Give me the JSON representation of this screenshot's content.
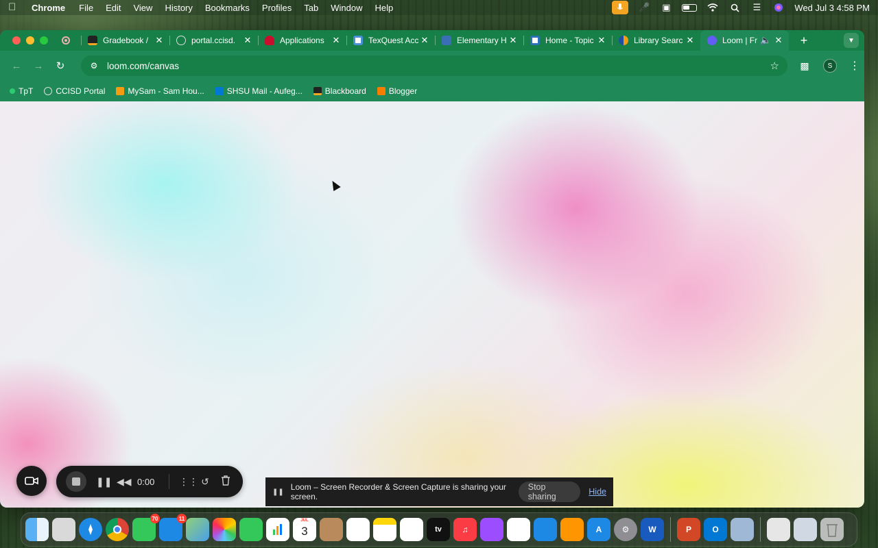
{
  "menubar": {
    "app_name": "Chrome",
    "menus": [
      "File",
      "Edit",
      "View",
      "History",
      "Bookmarks",
      "Profiles",
      "Tab",
      "Window",
      "Help"
    ],
    "datetime": "Wed Jul 3  4:58 PM"
  },
  "tabs": [
    {
      "title": "Gradebook /",
      "favicon_color": "#f5a623"
    },
    {
      "title": "portal.ccisd.",
      "favicon_color": "#cccccc"
    },
    {
      "title": "Applications",
      "favicon_color": "#c8102e"
    },
    {
      "title": "TexQuest Acc",
      "favicon_color": "#4a90d9"
    },
    {
      "title": "Elementary H",
      "favicon_color": "#3a6fb5"
    },
    {
      "title": "Home - Topic",
      "favicon_color": "#2d72b8"
    },
    {
      "title": "Library Searc",
      "favicon_color": "#f39c12"
    },
    {
      "title": "Loom | Fr",
      "favicon_color": "#625df5",
      "active": true
    }
  ],
  "toolbar": {
    "url": "loom.com/canvas",
    "profile_initial": "S"
  },
  "bookmarks": [
    {
      "label": "TpT",
      "color": "#2ecc71"
    },
    {
      "label": "CCISD Portal",
      "color": "#dddddd"
    },
    {
      "label": "MySam - Sam Hou...",
      "color": "#f39c12"
    },
    {
      "label": "SHSU Mail - Aufeg...",
      "color": "#0078d4"
    },
    {
      "label": "Blackboard",
      "color": "#f5a623"
    },
    {
      "label": "Blogger",
      "color": "#f57d00"
    }
  ],
  "loom": {
    "timer": "0:00"
  },
  "share_bar": {
    "message": "Loom – Screen Recorder & Screen Capture is sharing your screen.",
    "stop_label": "Stop sharing",
    "hide_label": "Hide"
  },
  "dock": {
    "mail_badge": "11",
    "messages_badge": "70",
    "calendar_month": "JUL",
    "calendar_day": "3"
  }
}
